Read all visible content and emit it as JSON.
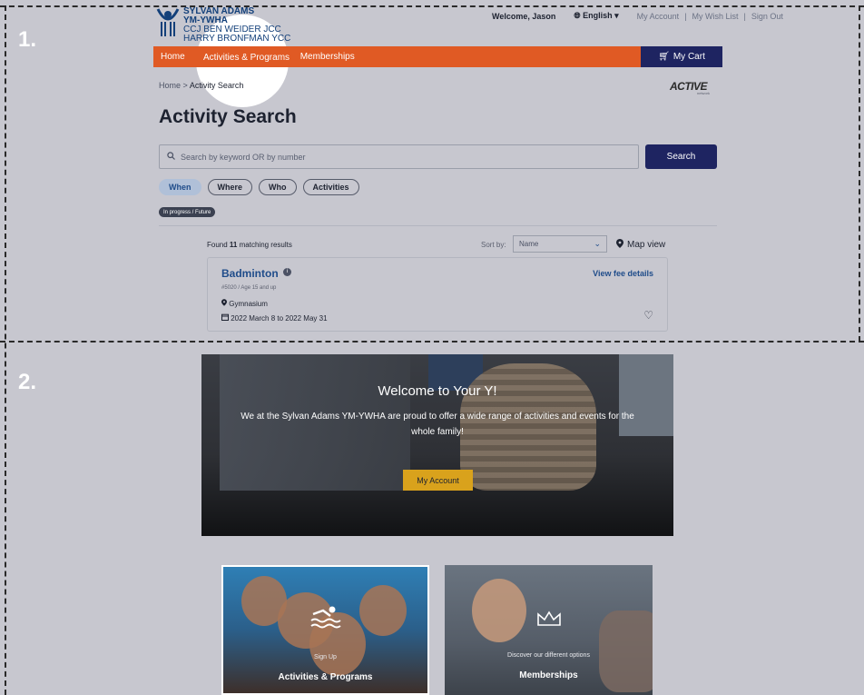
{
  "steps": [
    "1.",
    "2."
  ],
  "header": {
    "logo": {
      "line1": "SYLVAN ADAMS",
      "line2": "YM-YWHA",
      "line3": "CCJ BEN WEIDER JCC",
      "line4": "HARRY BRONFMAN YCC"
    },
    "welcome": "Welcome, Jason",
    "language": "English",
    "links": [
      "My Account",
      "My Wish List",
      "Sign Out"
    ]
  },
  "nav": {
    "items": [
      "Home",
      "Activities & Programs",
      "Memberships"
    ],
    "cart": "My Cart"
  },
  "breadcrumb": {
    "home": "Home",
    "separator": ">",
    "current": "Activity Search"
  },
  "brand_logo": {
    "name": "ACTIVE",
    "sub": "network"
  },
  "page_title": "Activity Search",
  "search": {
    "placeholder": "Search by keyword OR by number",
    "button": "Search"
  },
  "filters": [
    "When",
    "Where",
    "Who",
    "Activities"
  ],
  "status_tag": "In progress / Future",
  "results": {
    "found_prefix": "Found",
    "count": "11",
    "found_suffix": "matching results",
    "sort_label": "Sort by:",
    "sort_value": "Name",
    "map_view": "Map view"
  },
  "card": {
    "title": "Badminton",
    "fee_link": "View fee details",
    "meta": "#5020 / Age 15 and up",
    "location": "Gymnasium",
    "dates": "2022 March 8 to 2022 May 31"
  },
  "hero": {
    "title": "Welcome to Your Y!",
    "text": "We at the Sylvan Adams YM-YWHA are proud to offer a wide range of activities and events for the whole family!",
    "button": "My Account"
  },
  "tiles": [
    {
      "sub": "Sign Up",
      "title": "Activities & Programs",
      "icon": "swimmer-icon"
    },
    {
      "sub": "Discover our different options",
      "title": "Memberships",
      "icon": "crown-icon"
    }
  ],
  "colors": {
    "nav": "#e05a24",
    "cart": "#1e2461",
    "link": "#1f4c8a",
    "button_gold": "#d9a21c",
    "overlay": "#c7c7cf"
  }
}
